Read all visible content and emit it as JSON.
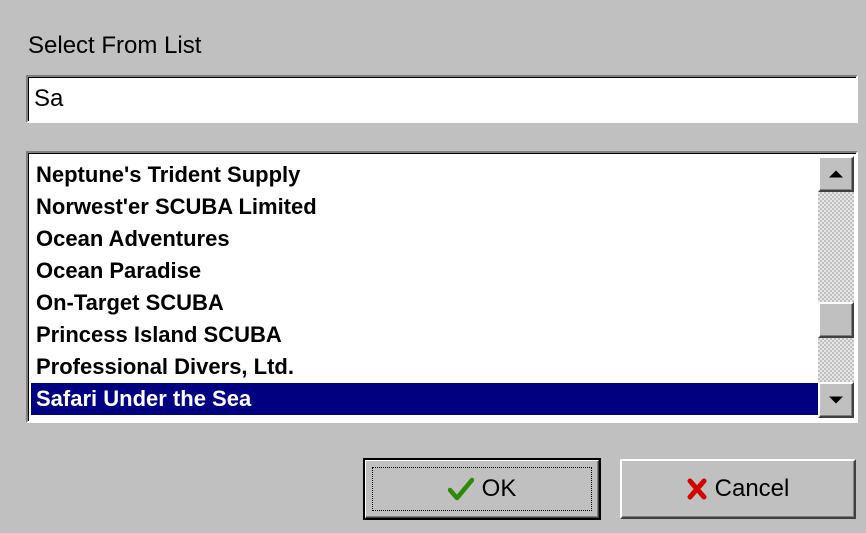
{
  "dialog": {
    "title": "Select From List"
  },
  "search": {
    "value": "Sa"
  },
  "list": {
    "items": [
      "Neptune's Trident Supply",
      "Norwest'er SCUBA Limited",
      "Ocean Adventures",
      "Ocean Paradise",
      "On-Target SCUBA",
      "Princess Island SCUBA",
      "Professional Divers, Ltd.",
      "Safari Under the Sea"
    ],
    "selected_index": 7
  },
  "buttons": {
    "ok_label": "OK",
    "cancel_label": "Cancel"
  },
  "icons": {
    "ok": "checkmark-icon",
    "cancel": "x-icon"
  },
  "colors": {
    "selection_bg": "#000080",
    "dialog_bg": "#c0c0c0",
    "ok_check": "#2e8b00",
    "cancel_x": "#d40000"
  }
}
